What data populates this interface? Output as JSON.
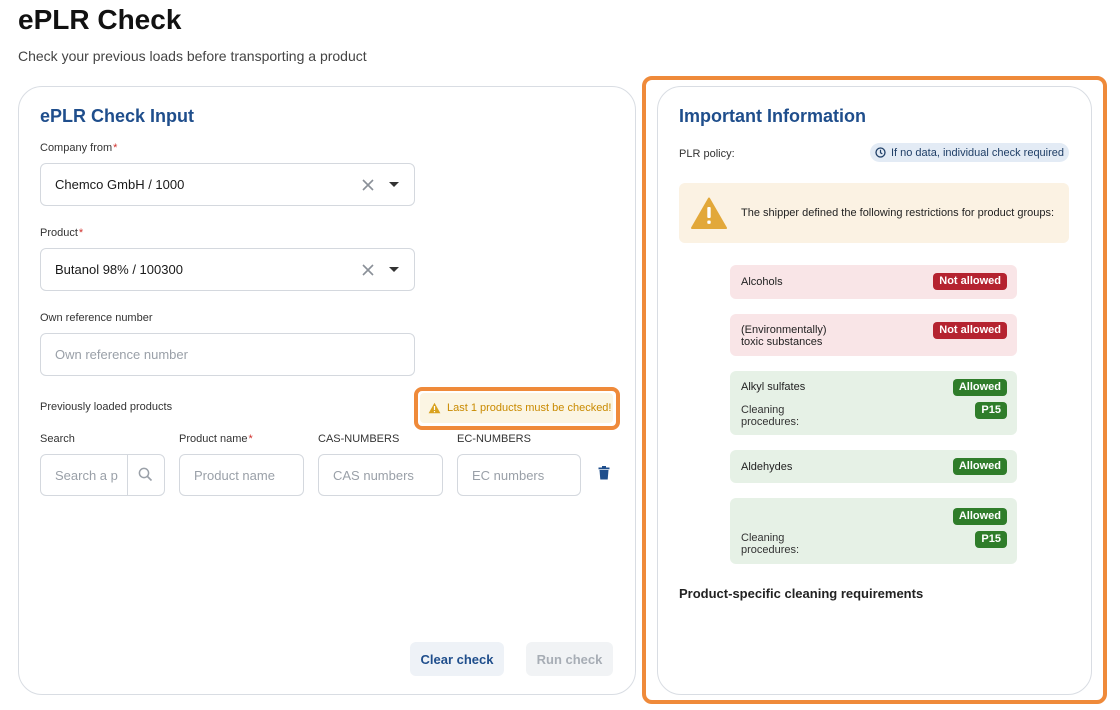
{
  "page": {
    "title": "ePLR Check",
    "subtitle": "Check your previous loads before transporting a product"
  },
  "input_card": {
    "title": "ePLR Check Input",
    "company_label": "Company from",
    "company_value": "Chemco GmbH / 1000",
    "product_label": "Product",
    "product_value": "Butanol 98% / 100300",
    "reference_label": "Own reference number",
    "reference_placeholder": "Own reference number",
    "previous_label": "Previously loaded products",
    "warning": "Last 1 products must be checked!",
    "columns": {
      "search": "Search",
      "product_name": "Product name",
      "cas": "CAS-NUMBERS",
      "ec": "EC-NUMBERS"
    },
    "placeholders": {
      "search": "Search a p",
      "product_name": "Product name",
      "cas": "CAS numbers",
      "ec": "EC numbers"
    },
    "clear_button": "Clear check",
    "run_button": "Run check"
  },
  "info_card": {
    "title": "Important Information",
    "policy_label": "PLR policy:",
    "policy_value": "If no data, individual check required",
    "notice": "The shipper defined the following restrictions for product groups:",
    "rules": [
      {
        "name": "Alcohols",
        "status": "Not allowed"
      },
      {
        "name_line1": "(Environmentally)",
        "name_line2": "toxic substances",
        "status": "Not allowed"
      },
      {
        "name": "Alkyl sulfates",
        "status": "Allowed",
        "sub_line1": "Cleaning",
        "sub_line2": "procedures:",
        "code": "P15"
      },
      {
        "name": "Aldehydes",
        "status": "Allowed"
      },
      {
        "status": "Allowed",
        "sub_line1": "Cleaning",
        "sub_line2": "procedures:",
        "code": "P15"
      }
    ],
    "cleaning_heading": "Product-specific cleaning requirements"
  },
  "colors": {
    "accent_blue": "#1f4e8c",
    "highlight_orange": "#ef8a3a",
    "not_allowed_red": "#b52330",
    "allowed_green": "#2f7d2a"
  }
}
